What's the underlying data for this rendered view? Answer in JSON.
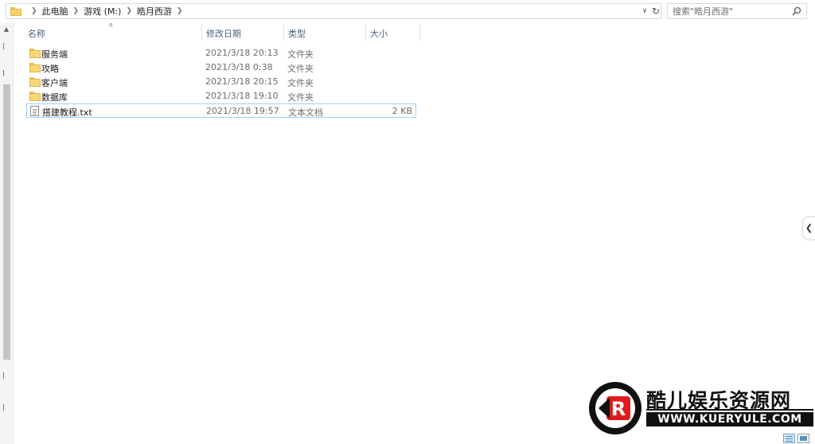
{
  "address_bar": {
    "crumbs": [
      "此电脑",
      "游戏 (M:)",
      "皓月西游"
    ]
  },
  "search": {
    "placeholder": "搜索\"皓月西游\""
  },
  "columns": {
    "name": "名称",
    "date": "修改日期",
    "type": "类型",
    "size": "大小"
  },
  "files": [
    {
      "name": "服务端",
      "date": "2021/3/18 20:13",
      "type": "文件夹",
      "size": "",
      "icon": "folder-icon"
    },
    {
      "name": "攻略",
      "date": "2021/3/18 0:38",
      "type": "文件夹",
      "size": "",
      "icon": "folder-icon"
    },
    {
      "name": "客户端",
      "date": "2021/3/18 20:15",
      "type": "文件夹",
      "size": "",
      "icon": "folder-icon"
    },
    {
      "name": "数据库",
      "date": "2021/3/18 19:10",
      "type": "文件夹",
      "size": "",
      "icon": "folder-icon"
    },
    {
      "name": "搭建教程.txt",
      "date": "2021/3/18 19:57",
      "type": "文本文档",
      "size": "2 KB",
      "icon": "text-file-icon"
    }
  ],
  "watermark": {
    "title": "酷儿娱乐资源网",
    "url": "WWW.KUERYULE.COM",
    "logo_letter": "R"
  },
  "colors": {
    "folder": "#f8d775",
    "selection_border": "#99d1ff",
    "header_text": "#4c607a",
    "watermark_red": "#e01b1b"
  }
}
